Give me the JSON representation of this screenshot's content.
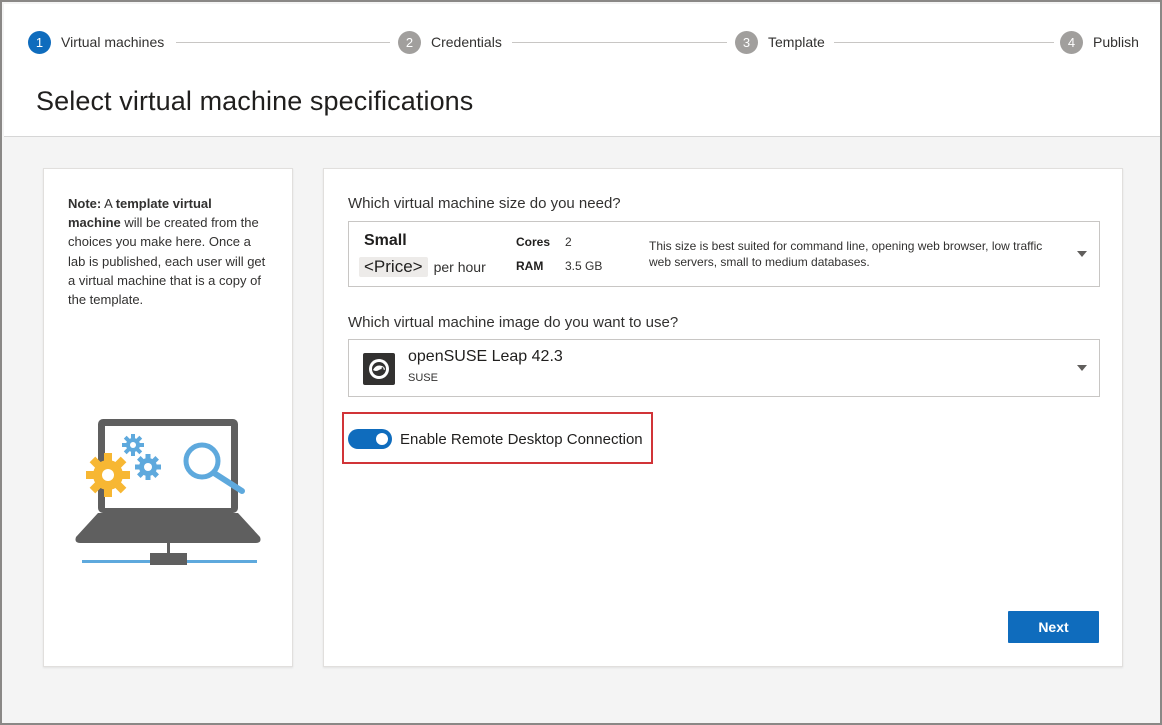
{
  "wizard": {
    "steps": [
      {
        "number": "1",
        "label": "Virtual machines",
        "state": "active"
      },
      {
        "number": "2",
        "label": "Credentials",
        "state": "inactive"
      },
      {
        "number": "3",
        "label": "Template",
        "state": "inactive"
      },
      {
        "number": "4",
        "label": "Publish",
        "state": "inactive"
      }
    ]
  },
  "page": {
    "title": "Select virtual machine specifications"
  },
  "note": {
    "prefix": "Note:",
    "text_1": " A ",
    "bold_term": "template virtual machine",
    "text_2": " will be created from the choices you make here. Once a lab is published, each user will get a virtual machine that is a copy of the template."
  },
  "size_section": {
    "question": "Which virtual machine size do you need?",
    "selected": {
      "name": "Small",
      "price": "<Price>",
      "price_suffix": "per hour",
      "cores_label": "Cores",
      "cores_value": "2",
      "ram_label": "RAM",
      "ram_value": "3.5 GB",
      "description": "This size is best suited for command line, opening web browser, low traffic web servers, small to medium databases."
    }
  },
  "image_section": {
    "question": "Which virtual machine image do you want to use?",
    "selected": {
      "name": "openSUSE Leap 42.3",
      "publisher": "SUSE",
      "icon": "opensuse-icon"
    }
  },
  "rdp_toggle": {
    "label": "Enable Remote Desktop Connection",
    "checked": true
  },
  "actions": {
    "next_label": "Next"
  },
  "colors": {
    "accent": "#0f6cbd",
    "highlight": "#d13438",
    "inactive_step": "#a19f9d"
  }
}
